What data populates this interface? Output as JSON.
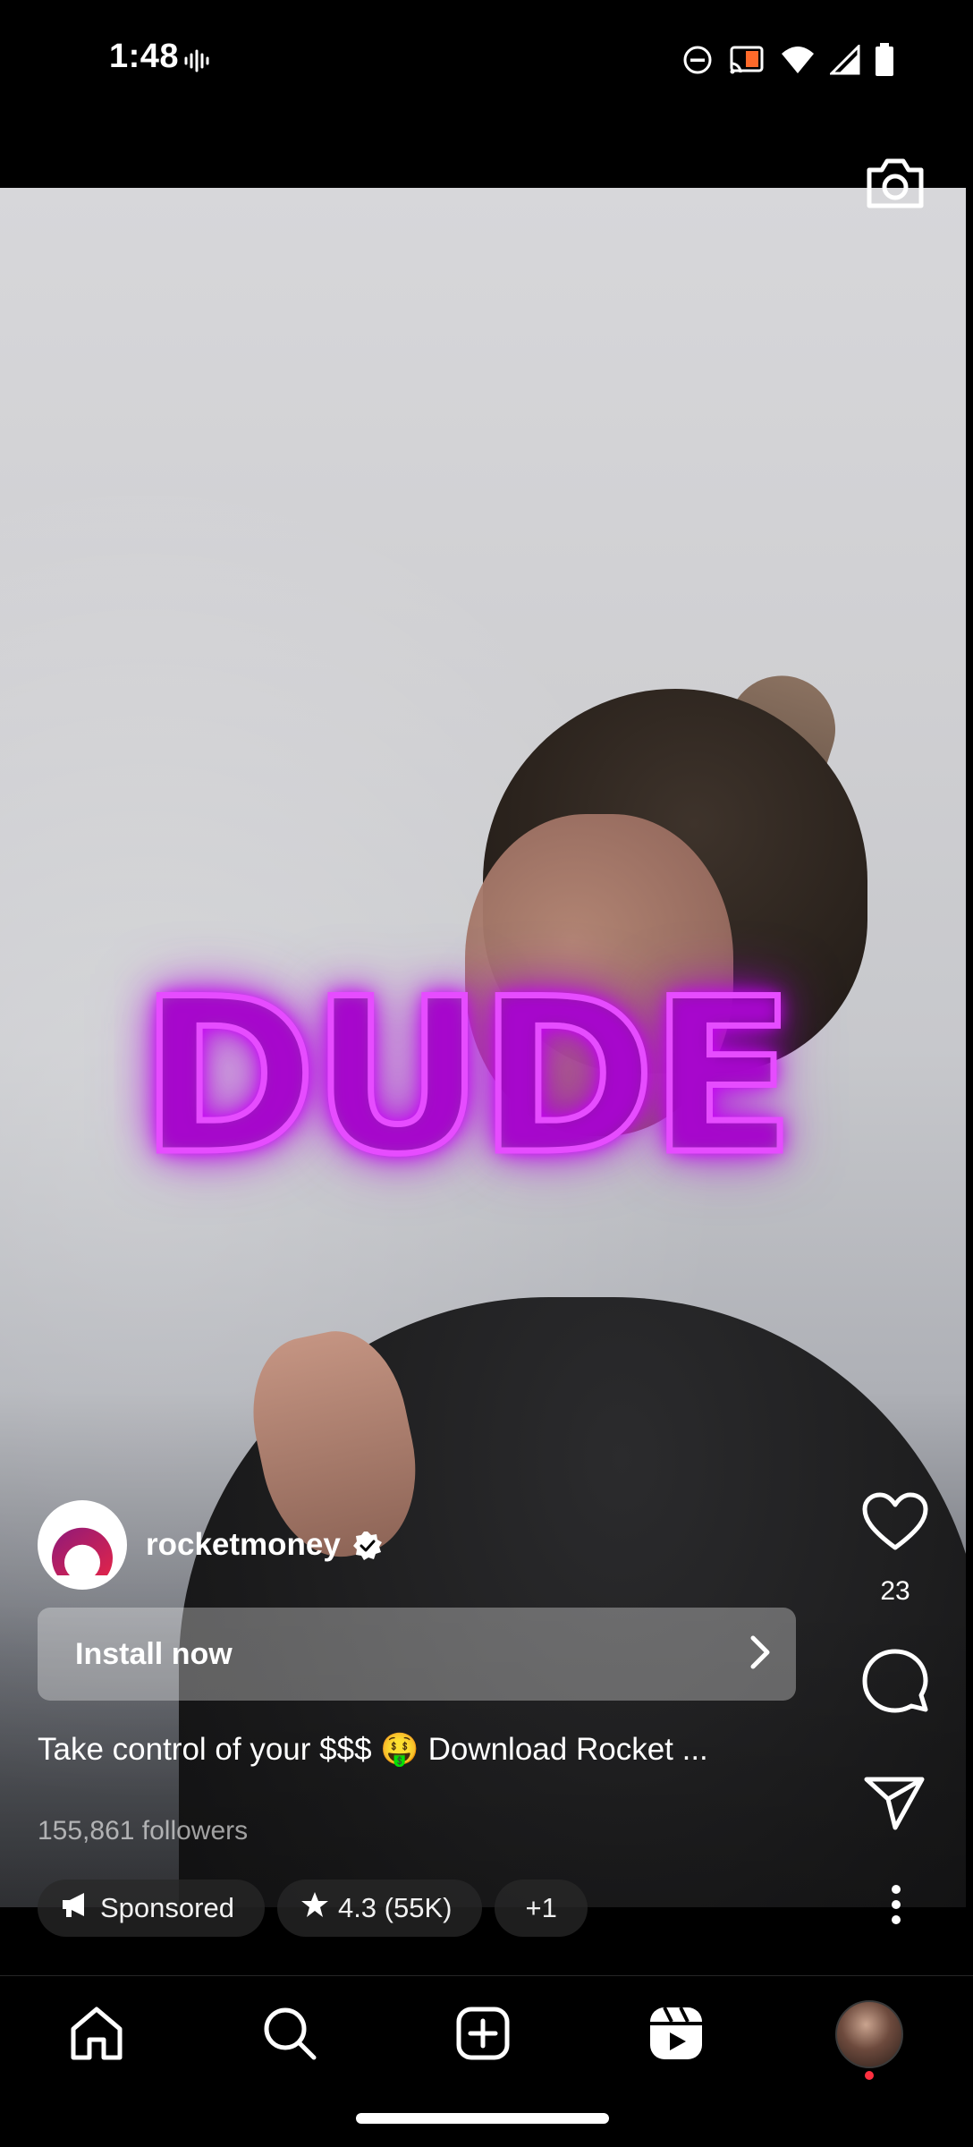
{
  "status_bar": {
    "time": "1:48",
    "icons": [
      "vibrate-icon",
      "do-not-disturb-icon",
      "cast-icon",
      "wifi-icon",
      "signal-icon",
      "battery-icon"
    ]
  },
  "video": {
    "overlay_text": "DUDE",
    "accent_color": "#e64cff"
  },
  "actions": {
    "like_count": "23",
    "icons": [
      "heart-icon",
      "comment-icon",
      "share-icon",
      "more-icon"
    ]
  },
  "author": {
    "username": "rocketmoney",
    "verified": true
  },
  "cta": {
    "install_label": "Install now"
  },
  "caption": "Take control of your $$$ 🤑 Download Rocket ...",
  "followers": "155,861 followers",
  "chips": {
    "sponsored": "Sponsored",
    "rating": "4.3 (55K)",
    "more": "+1"
  },
  "bottom_nav": {
    "items": [
      "home",
      "search",
      "create",
      "reels",
      "profile"
    ]
  },
  "colors": {
    "background": "#000000",
    "notification_dot": "#ff3040",
    "brand_ring": "#c2185b"
  }
}
